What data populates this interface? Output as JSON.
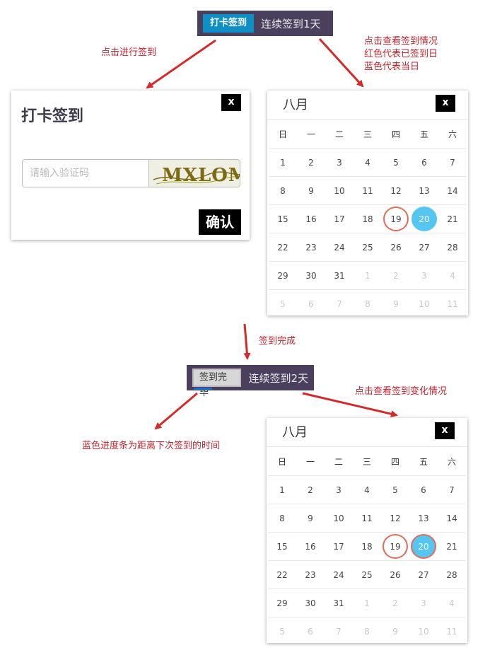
{
  "top_bar": {
    "button_label": "打卡签到",
    "streak_text": "连续签到1天"
  },
  "bottom_bar": {
    "button_label": "签到完毕",
    "streak_text": "连续签到2天",
    "progress": 0.4
  },
  "annotations": {
    "click_to_sign": "点击进行签到",
    "view_status_line1": "点击查看签到情况",
    "view_status_line2": "红色代表已签到日",
    "view_status_line3": "蓝色代表当日",
    "sign_done": "签到完成",
    "view_change": "点击查看签到变化情况",
    "progress_hint": "蓝色进度条为距离下次签到的时间"
  },
  "dialog": {
    "title": "打卡签到",
    "close_label": "x",
    "captcha_placeholder": "请输入验证码",
    "captcha_text": "MXLOM",
    "confirm_label": "确认"
  },
  "calendar_before": {
    "month": "八月",
    "close_label": "x",
    "weekdays": [
      "日",
      "一",
      "二",
      "三",
      "四",
      "五",
      "六"
    ],
    "weeks": [
      [
        {
          "d": "1"
        },
        {
          "d": "2"
        },
        {
          "d": "3"
        },
        {
          "d": "4"
        },
        {
          "d": "5"
        },
        {
          "d": "6"
        },
        {
          "d": "7"
        }
      ],
      [
        {
          "d": "8"
        },
        {
          "d": "9"
        },
        {
          "d": "10"
        },
        {
          "d": "11"
        },
        {
          "d": "12"
        },
        {
          "d": "13"
        },
        {
          "d": "14"
        }
      ],
      [
        {
          "d": "15"
        },
        {
          "d": "16"
        },
        {
          "d": "17"
        },
        {
          "d": "18"
        },
        {
          "d": "19",
          "signed": true
        },
        {
          "d": "20",
          "today": true
        },
        {
          "d": "21"
        }
      ],
      [
        {
          "d": "22"
        },
        {
          "d": "23"
        },
        {
          "d": "24"
        },
        {
          "d": "25"
        },
        {
          "d": "26"
        },
        {
          "d": "27"
        },
        {
          "d": "28"
        }
      ],
      [
        {
          "d": "29"
        },
        {
          "d": "30"
        },
        {
          "d": "31"
        },
        {
          "d": "1",
          "dim": true
        },
        {
          "d": "2",
          "dim": true
        },
        {
          "d": "3",
          "dim": true
        },
        {
          "d": "4",
          "dim": true
        }
      ],
      [
        {
          "d": "5",
          "dim": true
        },
        {
          "d": "6",
          "dim": true
        },
        {
          "d": "7",
          "dim": true
        },
        {
          "d": "8",
          "dim": true
        },
        {
          "d": "9",
          "dim": true
        },
        {
          "d": "10",
          "dim": true
        },
        {
          "d": "11",
          "dim": true
        }
      ]
    ]
  },
  "calendar_after": {
    "month": "八月",
    "close_label": "x",
    "weekdays": [
      "日",
      "一",
      "二",
      "三",
      "四",
      "五",
      "六"
    ],
    "weeks": [
      [
        {
          "d": "1"
        },
        {
          "d": "2"
        },
        {
          "d": "3"
        },
        {
          "d": "4"
        },
        {
          "d": "5"
        },
        {
          "d": "6"
        },
        {
          "d": "7"
        }
      ],
      [
        {
          "d": "8"
        },
        {
          "d": "9"
        },
        {
          "d": "10"
        },
        {
          "d": "11"
        },
        {
          "d": "12"
        },
        {
          "d": "13"
        },
        {
          "d": "14"
        }
      ],
      [
        {
          "d": "15"
        },
        {
          "d": "16"
        },
        {
          "d": "17"
        },
        {
          "d": "18"
        },
        {
          "d": "19",
          "signed": true
        },
        {
          "d": "20",
          "today": true,
          "signed": true
        },
        {
          "d": "21"
        }
      ],
      [
        {
          "d": "22"
        },
        {
          "d": "23"
        },
        {
          "d": "24"
        },
        {
          "d": "25"
        },
        {
          "d": "26"
        },
        {
          "d": "27"
        },
        {
          "d": "28"
        }
      ],
      [
        {
          "d": "29"
        },
        {
          "d": "30"
        },
        {
          "d": "31"
        },
        {
          "d": "1",
          "dim": true
        },
        {
          "d": "2",
          "dim": true
        },
        {
          "d": "3",
          "dim": true
        },
        {
          "d": "4",
          "dim": true
        }
      ],
      [
        {
          "d": "5",
          "dim": true
        },
        {
          "d": "6",
          "dim": true
        },
        {
          "d": "7",
          "dim": true
        },
        {
          "d": "8",
          "dim": true
        },
        {
          "d": "9",
          "dim": true
        },
        {
          "d": "10",
          "dim": true
        },
        {
          "d": "11",
          "dim": true
        }
      ]
    ]
  },
  "colors": {
    "bar_bg": "#4a3f5c",
    "sign_button": "#0e8fc6",
    "signed_ring": "#e26b5c",
    "today_fill": "#55c6f2",
    "progress": "#1a6fd4",
    "arrow": "#d42a2a",
    "annotation": "#c0232e"
  }
}
